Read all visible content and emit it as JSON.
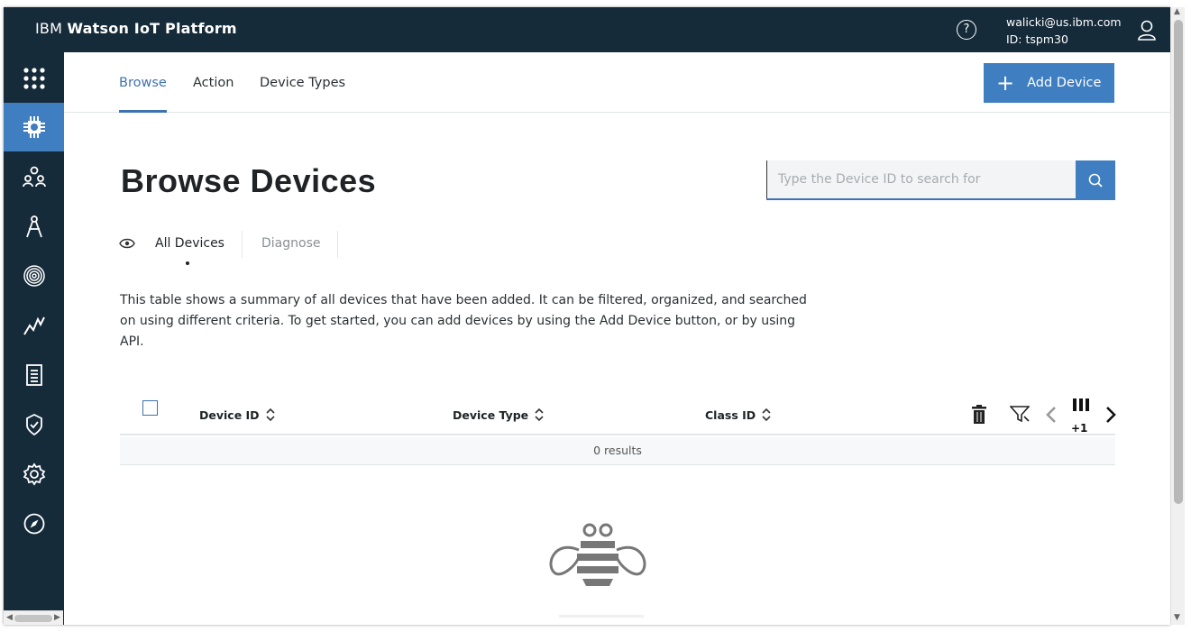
{
  "header": {
    "brand_prefix": "IBM",
    "brand_name": "Watson IoT Platform",
    "user_email": "walicki@us.ibm.com",
    "user_id": "ID: tspm30",
    "help_glyph": "?"
  },
  "sidebar": {
    "items": [
      {
        "name": "app-switcher-icon"
      },
      {
        "name": "devices-icon",
        "active": true
      },
      {
        "name": "members-icon"
      },
      {
        "name": "apps-icon"
      },
      {
        "name": "security-fingerprint-icon"
      },
      {
        "name": "usage-icon"
      },
      {
        "name": "logs-icon"
      },
      {
        "name": "compliance-icon"
      },
      {
        "name": "settings-icon"
      },
      {
        "name": "explore-compass-icon"
      }
    ]
  },
  "tabs": [
    {
      "label": "Browse",
      "active": true
    },
    {
      "label": "Action"
    },
    {
      "label": "Device Types"
    }
  ],
  "add_device": {
    "plus": "+",
    "label": "Add Device"
  },
  "page_title": "Browse Devices",
  "search": {
    "placeholder": "Type the Device ID to search for"
  },
  "subtabs": {
    "all": "All Devices",
    "diagnose": "Diagnose"
  },
  "description": "This table shows a summary of all devices that have been added. It can be filtered, organized, and searched on using different criteria. To get started, you can add devices by using the Add Device button, or by using API.",
  "table": {
    "columns": [
      "Device ID",
      "Device Type",
      "Class ID"
    ],
    "extra_columns": "+1",
    "results": "0 results"
  },
  "colors": {
    "accent": "#3f7ec0",
    "nav_bg": "#162b3a"
  }
}
